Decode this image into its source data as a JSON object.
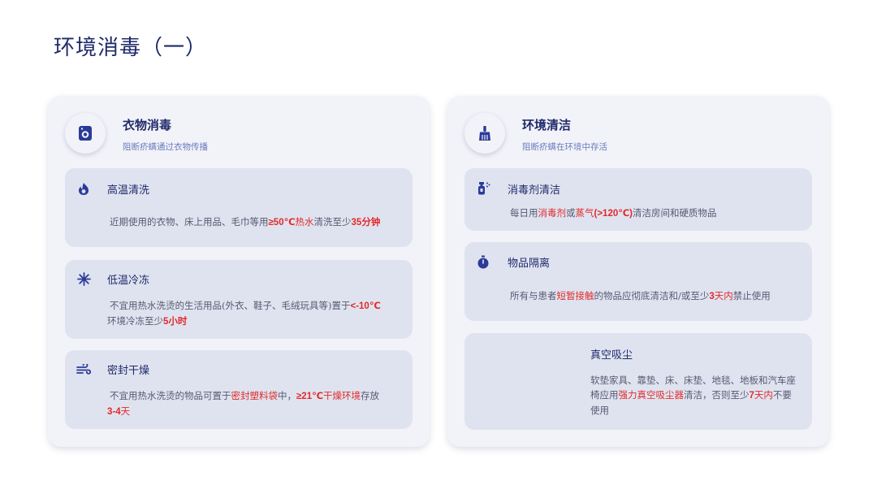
{
  "title": "环境消毒（一）",
  "colors": {
    "accent": "#2b3a99",
    "highlight": "#e12a2a",
    "panel": "#f2f3f8",
    "card": "#dfe3ef"
  },
  "left": {
    "icon": "washing-machine-icon",
    "title": "衣物消毒",
    "subtitle": "阻断疥螨通过衣物传播",
    "cards": [
      {
        "icon": "flame-icon",
        "title": "高温清洗",
        "t1": "近期使用的衣物、床上用品、毛巾等用",
        "h1": "≥50℃",
        "h1b": "热水",
        "t2": "清洗至少",
        "h2": "35分钟"
      },
      {
        "icon": "snowflake-icon",
        "title": "低温冷冻",
        "t1": "不宜用热水洗烫的生活用品(外衣、鞋子、毛绒玩具等)置于",
        "h1": "<-10℃",
        "t2": "环境冷冻至少",
        "h2": "5小时"
      },
      {
        "icon": "wind-icon",
        "title": "密封干燥",
        "t1": "不宜用热水洗烫的物品可置于",
        "h1": "密封塑料袋",
        "t2": "中，",
        "h2": "≥21℃",
        "h2b": "干燥环境",
        "t3": "存放",
        "h3": "3-4",
        "h3b": "天"
      }
    ]
  },
  "right": {
    "icon": "broom-icon",
    "title": "环境清洁",
    "subtitle": "阻断疥螨在环境中存活",
    "cards": [
      {
        "icon": "spray-bottle-icon",
        "title": "消毒剂清洁",
        "t1": "每日用",
        "h1": "消毒剂",
        "t2": "或",
        "h2": "蒸气",
        "h2b": "(>120℃)",
        "t3": "清洁房间和硬质物品"
      },
      {
        "icon": "stopwatch-icon",
        "title": "物品隔离",
        "t1": "所有与患者",
        "h1": "短暂接触",
        "t2": "的物品应彻底清洁和/或至少",
        "h2": "3",
        "h2b": "天内",
        "t3": "禁止使用"
      },
      {
        "title": "真空吸尘",
        "t1": "软垫家具、靠垫、床、床垫、地毯、地板和汽车座椅应用",
        "h1": "强力真空吸尘器",
        "t2": "清洁，否则至少",
        "h2": "7",
        "h2b": "天内",
        "t3": "不要使用"
      }
    ]
  }
}
